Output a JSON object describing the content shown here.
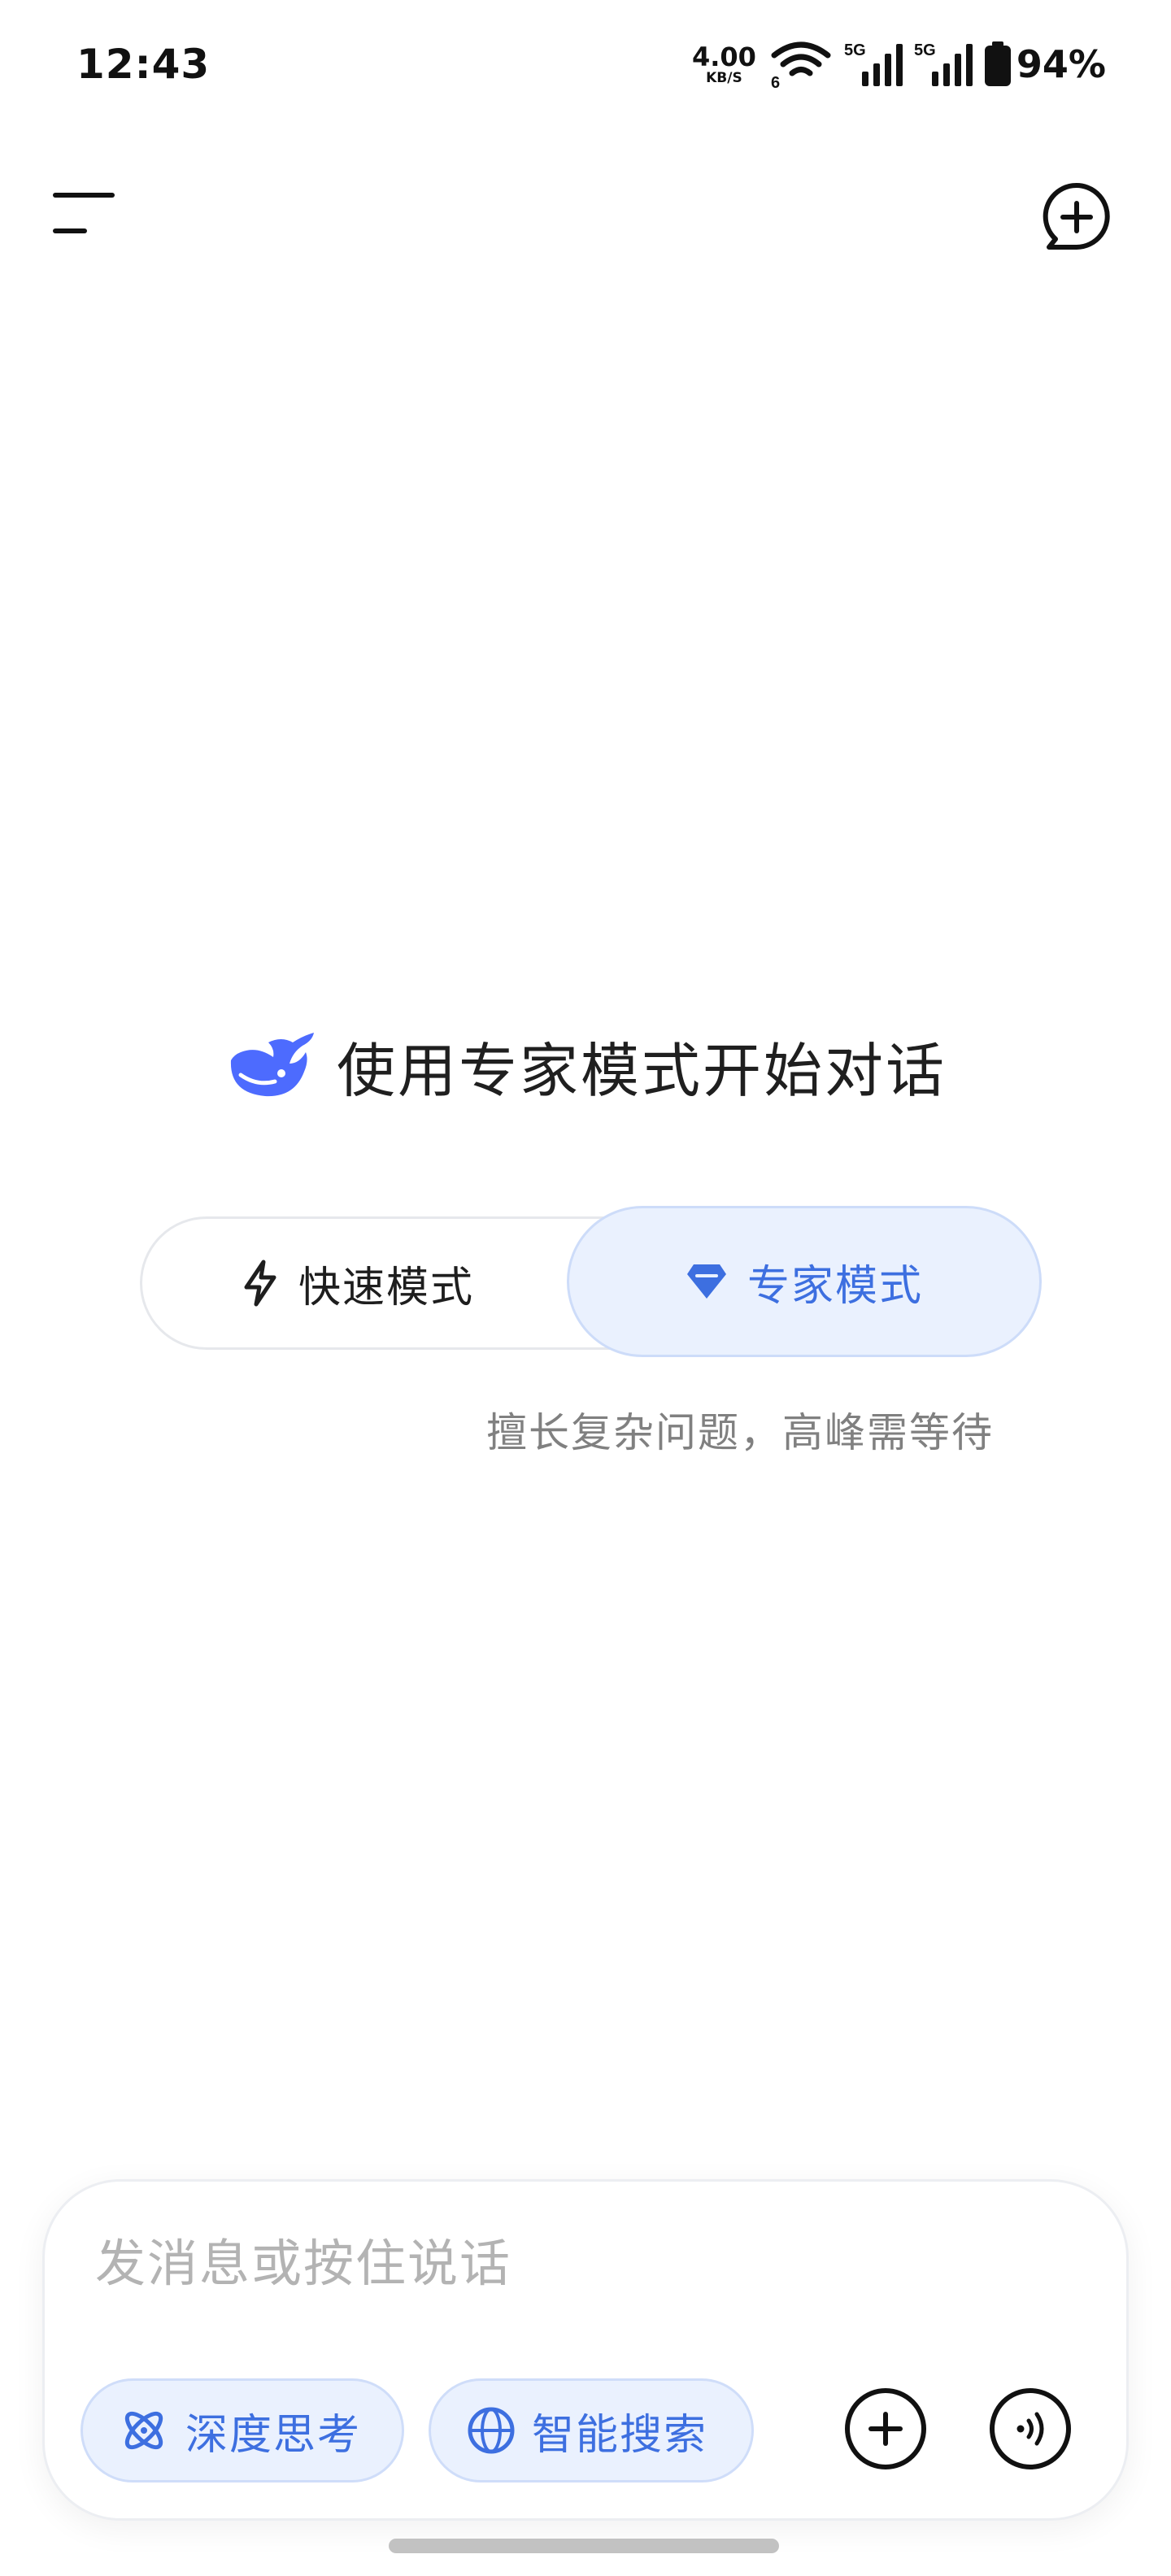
{
  "status_bar": {
    "time": "12:43",
    "net_speed_value": "4.00",
    "net_speed_unit": "KB/S",
    "wifi_badge": "6",
    "signal1_label": "5G",
    "signal2_label": "5G",
    "battery": "94%",
    "battery_level": 0.94,
    "icons": [
      "wifi-icon",
      "cellular-signal-icon",
      "cellular-signal-icon",
      "battery-icon"
    ]
  },
  "top_bar": {
    "left_icon": "menu-icon",
    "right_icon": "new-chat-icon"
  },
  "hero": {
    "logo": "whale-logo",
    "title": "使用专家模式开始对话"
  },
  "mode_toggle": {
    "fast_label": "快速模式",
    "fast_icon": "lightning-icon",
    "expert_label": "专家模式",
    "expert_icon": "diamond-icon",
    "selected": "专家模式",
    "hint": "擅长复杂问题，高峰需等待"
  },
  "composer": {
    "placeholder": "发消息或按住说话",
    "deep_think_label": "深度思考",
    "deep_think_icon": "atom-icon",
    "smart_search_label": "智能搜索",
    "smart_search_icon": "globe-icon",
    "attach_icon": "plus-circle-icon",
    "voice_icon": "voice-wave-icon"
  },
  "colors": {
    "accent": "#3d6fe0",
    "accent_bg": "#eaf1fe",
    "text_primary": "#1f1f1f",
    "text_hint": "#808080",
    "placeholder": "#b3b3b3"
  }
}
